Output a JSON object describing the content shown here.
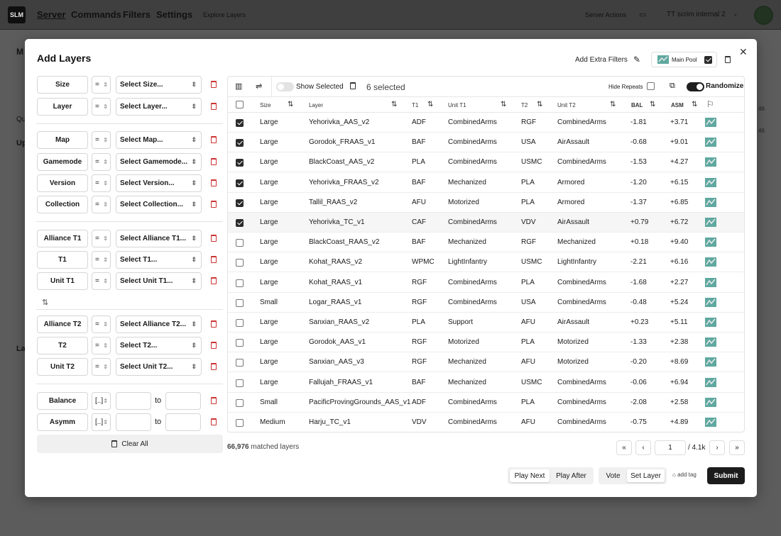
{
  "app": {
    "logo": "SLM",
    "nav": [
      "Server",
      "Commands",
      "Filters",
      "Settings"
    ],
    "explore_layers": "Explore Layers",
    "server_actions": "Server Actions",
    "server_name": "TT scrim internal 2"
  },
  "background": {
    "m": "M",
    "up": "Up",
    "qu": "Qu",
    "la": "La",
    "right_numbers": [
      "46",
      "46"
    ]
  },
  "modal": {
    "title": "Add Layers",
    "add_extra_filters": "Add Extra Filters",
    "main_pool": "Main Pool",
    "filters": [
      {
        "name": "Size",
        "op": "=",
        "select": "Select Size..."
      },
      {
        "name": "Layer",
        "op": "=",
        "select": "Select Layer..."
      },
      {
        "name": "Map",
        "op": "=",
        "select": "Select Map..."
      },
      {
        "name": "Gamemode",
        "op": "=",
        "select": "Select Gamemode..."
      },
      {
        "name": "Version",
        "op": "=",
        "select": "Select Version..."
      },
      {
        "name": "Collection",
        "op": "=",
        "select": "Select Collection..."
      },
      {
        "name": "Alliance T1",
        "op": "=",
        "select": "Select Alliance T1..."
      },
      {
        "name": "T1",
        "op": "=",
        "select": "Select T1..."
      },
      {
        "name": "Unit T1",
        "op": "=",
        "select": "Select Unit T1..."
      },
      {
        "name": "Alliance T2",
        "op": "=",
        "select": "Select Alliance T2..."
      },
      {
        "name": "T2",
        "op": "=",
        "select": "Select T2..."
      },
      {
        "name": "Unit T2",
        "op": "=",
        "select": "Select Unit T2..."
      }
    ],
    "range_filters": [
      {
        "name": "Balance",
        "op": "[..]",
        "to": "to"
      },
      {
        "name": "Asymm",
        "op": "[..]",
        "to": "to"
      }
    ],
    "clear_all": "Clear All",
    "toolbar": {
      "show_selected": "Show Selected",
      "selected_count": "6 selected",
      "hide_repeats": "Hide Repeats",
      "randomize": "Randomize"
    },
    "columns": [
      "Size",
      "Layer",
      "T1",
      "Unit T1",
      "T2",
      "Unit T2",
      "BAL",
      "ASM"
    ],
    "rows": [
      {
        "checked": true,
        "size": "Large",
        "layer": "Yehorivka_AAS_v2",
        "t1": "ADF",
        "unit1": "CombinedArms",
        "t2": "RGF",
        "unit2": "CombinedArms",
        "bal": "-1.81",
        "asm": "+3.71"
      },
      {
        "checked": true,
        "size": "Large",
        "layer": "Gorodok_FRAAS_v1",
        "t1": "BAF",
        "unit1": "CombinedArms",
        "t2": "USA",
        "unit2": "AirAssault",
        "bal": "-0.68",
        "asm": "+9.01"
      },
      {
        "checked": true,
        "size": "Large",
        "layer": "BlackCoast_AAS_v2",
        "t1": "PLA",
        "unit1": "CombinedArms",
        "t2": "USMC",
        "unit2": "CombinedArms",
        "bal": "-1.53",
        "asm": "+4.27"
      },
      {
        "checked": true,
        "size": "Large",
        "layer": "Yehorivka_FRAAS_v2",
        "t1": "BAF",
        "unit1": "Mechanized",
        "t2": "PLA",
        "unit2": "Armored",
        "bal": "-1.20",
        "asm": "+6.15"
      },
      {
        "checked": true,
        "size": "Large",
        "layer": "Tallil_RAAS_v2",
        "t1": "AFU",
        "unit1": "Motorized",
        "t2": "PLA",
        "unit2": "Armored",
        "bal": "-1.37",
        "asm": "+6.85"
      },
      {
        "checked": true,
        "size": "Large",
        "layer": "Yehorivka_TC_v1",
        "t1": "CAF",
        "unit1": "CombinedArms",
        "t2": "VDV",
        "unit2": "AirAssault",
        "bal": "+0.79",
        "asm": "+6.72"
      },
      {
        "checked": false,
        "size": "Large",
        "layer": "BlackCoast_RAAS_v2",
        "t1": "BAF",
        "unit1": "Mechanized",
        "t2": "RGF",
        "unit2": "Mechanized",
        "bal": "+0.18",
        "asm": "+9.40"
      },
      {
        "checked": false,
        "size": "Large",
        "layer": "Kohat_RAAS_v2",
        "t1": "WPMC",
        "unit1": "LightInfantry",
        "t2": "USMC",
        "unit2": "LightInfantry",
        "bal": "-2.21",
        "asm": "+6.16"
      },
      {
        "checked": false,
        "size": "Large",
        "layer": "Kohat_RAAS_v1",
        "t1": "RGF",
        "unit1": "CombinedArms",
        "t2": "PLA",
        "unit2": "CombinedArms",
        "bal": "-1.68",
        "asm": "+2.27"
      },
      {
        "checked": false,
        "size": "Small",
        "layer": "Logar_RAAS_v1",
        "t1": "RGF",
        "unit1": "CombinedArms",
        "t2": "USA",
        "unit2": "CombinedArms",
        "bal": "-0.48",
        "asm": "+5.24"
      },
      {
        "checked": false,
        "size": "Large",
        "layer": "Sanxian_RAAS_v2",
        "t1": "PLA",
        "unit1": "Support",
        "t2": "AFU",
        "unit2": "AirAssault",
        "bal": "+0.23",
        "asm": "+5.11"
      },
      {
        "checked": false,
        "size": "Large",
        "layer": "Gorodok_AAS_v1",
        "t1": "RGF",
        "unit1": "Motorized",
        "t2": "PLA",
        "unit2": "Motorized",
        "bal": "-1.33",
        "asm": "+2.38"
      },
      {
        "checked": false,
        "size": "Large",
        "layer": "Sanxian_AAS_v3",
        "t1": "RGF",
        "unit1": "Mechanized",
        "t2": "AFU",
        "unit2": "Motorized",
        "bal": "-0.20",
        "asm": "+8.69"
      },
      {
        "checked": false,
        "size": "Large",
        "layer": "Fallujah_FRAAS_v1",
        "t1": "BAF",
        "unit1": "Mechanized",
        "t2": "USMC",
        "unit2": "CombinedArms",
        "bal": "-0.06",
        "asm": "+6.94"
      },
      {
        "checked": false,
        "size": "Small",
        "layer": "PacificProvingGrounds_AAS_v1",
        "t1": "ADF",
        "unit1": "CombinedArms",
        "t2": "PLA",
        "unit2": "CombinedArms",
        "bal": "-2.08",
        "asm": "+2.58"
      },
      {
        "checked": false,
        "size": "Medium",
        "layer": "Harju_TC_v1",
        "t1": "VDV",
        "unit1": "CombinedArms",
        "t2": "AFU",
        "unit2": "CombinedArms",
        "bal": "-0.75",
        "asm": "+4.89"
      }
    ],
    "matched_count": "66,976",
    "matched_label": "matched layers",
    "page_current": "1",
    "page_total": "/ 4.1k",
    "actions": {
      "play_next": "Play Next",
      "play_after": "Play After",
      "vote": "Vote",
      "set_layer": "Set Layer",
      "add_tag": "add tag",
      "submit": "Submit"
    }
  },
  "colors": {
    "accent": "#1c1c1c",
    "delete": "#cc3333",
    "overlay": "#5c5c5c"
  }
}
